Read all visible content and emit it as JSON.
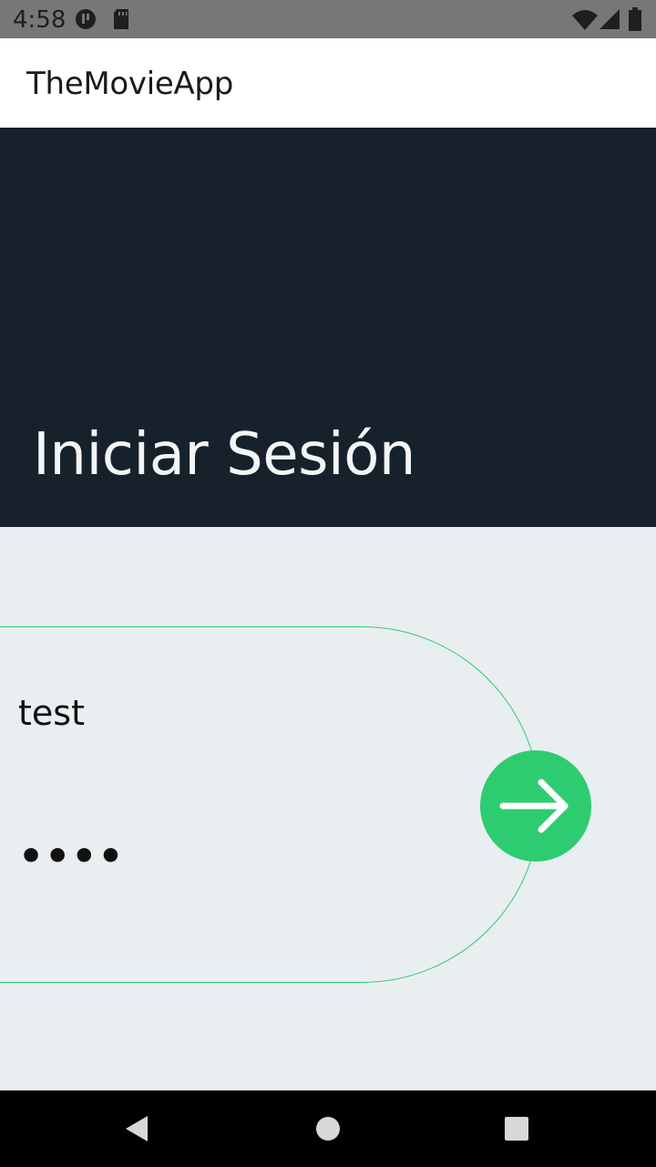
{
  "status_bar": {
    "time": "4:58",
    "icons": [
      "app-notification-icon",
      "sd-card-icon",
      "wifi-icon",
      "signal-icon",
      "battery-icon"
    ]
  },
  "app_bar": {
    "title": "TheMovieApp"
  },
  "hero": {
    "title": "Iniciar Sesión"
  },
  "login": {
    "username_value": "test",
    "password_display": "••••",
    "submit_icon": "arrow-right-icon"
  },
  "nav_bar": {
    "icons": [
      "back-icon",
      "home-icon",
      "recents-icon"
    ]
  },
  "colors": {
    "status_bar_bg": "#777777",
    "hero_bg": "#17212b",
    "content_bg": "#e9eef0",
    "accent": "#2ecc71"
  }
}
